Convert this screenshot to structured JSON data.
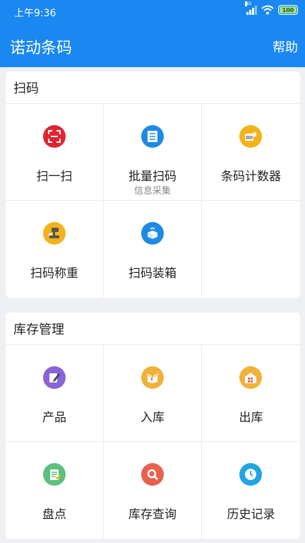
{
  "status_bar": {
    "time": "上午9:36",
    "network": "HD",
    "battery": "100"
  },
  "header": {
    "title": "诺动条码",
    "help_label": "帮助"
  },
  "sections": [
    {
      "title": "扫码",
      "items": [
        {
          "label": "扫一扫",
          "sublabel": "",
          "icon": "scan-frame-icon",
          "color": "#e02433"
        },
        {
          "label": "批量扫码",
          "sublabel": "信息采集",
          "icon": "document-list-icon",
          "color": "#1e8ae6"
        },
        {
          "label": "条码计数器",
          "sublabel": "",
          "icon": "barcode-counter-icon",
          "color": "#f5b21b"
        },
        {
          "label": "扫码称重",
          "sublabel": "",
          "icon": "weighing-scale-icon",
          "color": "#f5b21b"
        },
        {
          "label": "扫码装箱",
          "sublabel": "",
          "icon": "packing-box-icon",
          "color": "#1e8ae6"
        }
      ]
    },
    {
      "title": "库存管理",
      "items": [
        {
          "label": "产品",
          "sublabel": "",
          "icon": "edit-product-icon",
          "color": "#8b63d9"
        },
        {
          "label": "入库",
          "sublabel": "",
          "icon": "open-box-icon",
          "color": "#f0b23a"
        },
        {
          "label": "出库",
          "sublabel": "",
          "icon": "warehouse-icon",
          "color": "#f0b23a"
        },
        {
          "label": "盘点",
          "sublabel": "",
          "icon": "checklist-icon",
          "color": "#5fbf7f"
        },
        {
          "label": "库存查询",
          "sublabel": "",
          "icon": "search-icon",
          "color": "#e8614f"
        },
        {
          "label": "历史记录",
          "sublabel": "",
          "icon": "clock-icon",
          "color": "#22a5e0"
        }
      ]
    }
  ]
}
